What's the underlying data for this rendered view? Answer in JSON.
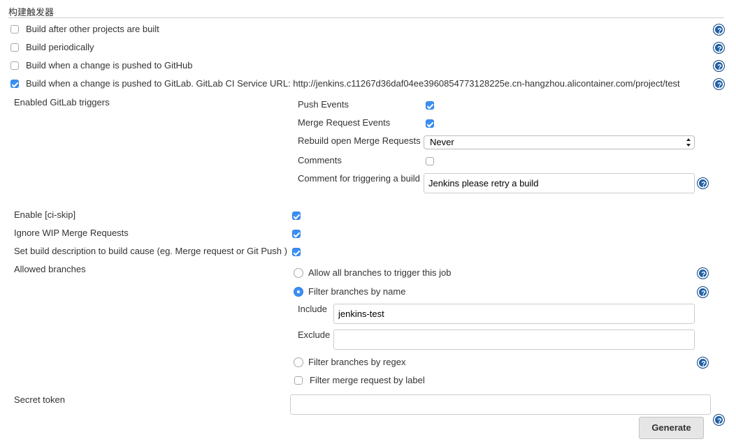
{
  "section": {
    "title": "构建触发器"
  },
  "triggers": [
    {
      "label": "Build after other projects are built",
      "checked": false
    },
    {
      "label": "Build periodically",
      "checked": false
    },
    {
      "label": "Build when a change is pushed to GitHub",
      "checked": false
    },
    {
      "label": "Build when a change is pushed to GitLab. GitLab CI Service URL: http://jenkins.c11267d36daf04ee3960854773128225e.cn-hangzhou.alicontainer.com/project/test",
      "checked": true
    }
  ],
  "gitlab": {
    "enabled_triggers_label": "Enabled GitLab triggers",
    "push_events": {
      "label": "Push Events",
      "checked": true
    },
    "merge_request_events": {
      "label": "Merge Request Events",
      "checked": true
    },
    "rebuild_open_mr": {
      "label": "Rebuild open Merge Requests",
      "value": "Never"
    },
    "comments": {
      "label": "Comments",
      "checked": false
    },
    "comment_trigger": {
      "label": "Comment for triggering a build",
      "value": "Jenkins please retry a build"
    },
    "ci_skip": {
      "label": "Enable [ci-skip]",
      "checked": true
    },
    "ignore_wip": {
      "label": "Ignore WIP Merge Requests",
      "checked": true
    },
    "set_description": {
      "label": "Set build description to build cause (eg. Merge request or Git Push )",
      "checked": true
    },
    "allowed_branches": {
      "label": "Allowed branches",
      "options": [
        {
          "label": "Allow all branches to trigger this job",
          "selected": false
        },
        {
          "label": "Filter branches by name",
          "selected": true
        },
        {
          "label": "Filter branches by regex",
          "selected": false
        }
      ],
      "include_label": "Include",
      "include_value": "jenkins-test",
      "exclude_label": "Exclude",
      "exclude_value": "",
      "filter_by_label": {
        "label": "Filter merge request by label",
        "checked": false
      }
    },
    "secret_token": {
      "label": "Secret token",
      "value": "",
      "generate_label": "Generate"
    }
  },
  "colors": {
    "accent": "#3b8ff3",
    "help_icon": "#1e5ea6"
  }
}
